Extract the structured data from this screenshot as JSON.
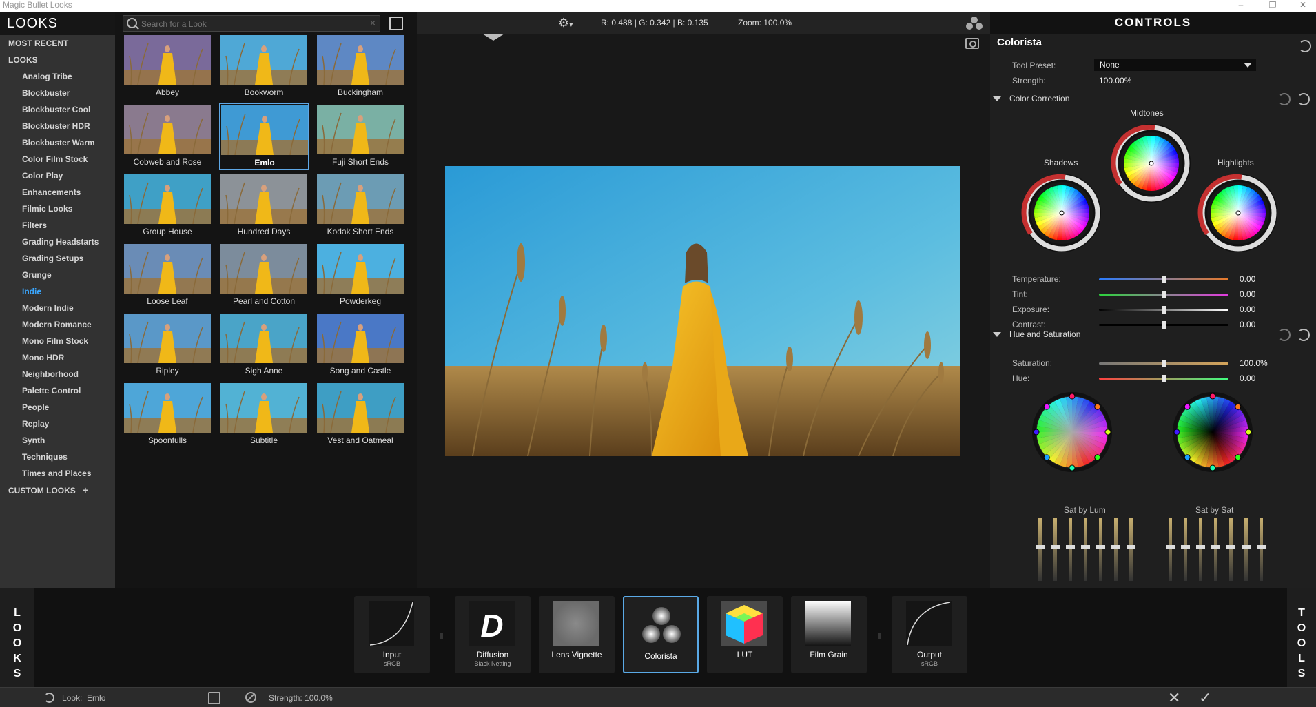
{
  "window": {
    "title": "Magic Bullet Looks"
  },
  "looks_panel": {
    "header": "LOOKS",
    "top_items": [
      "MOST RECENT",
      "LOOKS"
    ],
    "categories": [
      "Analog Tribe",
      "Blockbuster",
      "Blockbuster Cool",
      "Blockbuster HDR",
      "Blockbuster Warm",
      "Color Film Stock",
      "Color Play",
      "Enhancements",
      "Filmic Looks",
      "Filters",
      "Grading Headstarts",
      "Grading Setups",
      "Grunge",
      "Indie",
      "Modern Indie",
      "Modern Romance",
      "Mono Film Stock",
      "Mono HDR",
      "Neighborhood",
      "Palette Control",
      "People",
      "Replay",
      "Synth",
      "Techniques",
      "Times and Places"
    ],
    "selected_category": "Indie",
    "custom_looks": "CUSTOM LOOKS",
    "custom_plus": "+"
  },
  "search": {
    "placeholder": "Search for a Look",
    "clear": "×"
  },
  "thumbnails": [
    {
      "label": "Abbey",
      "tint": "#7a6a9a"
    },
    {
      "label": "Bookworm",
      "tint": "#4fa8d6"
    },
    {
      "label": "Buckingham",
      "tint": "#5e88c4"
    },
    {
      "label": "Cobweb and Rose",
      "tint": "#8a7a8e"
    },
    {
      "label": "Emlo",
      "tint": "#3f9ad4"
    },
    {
      "label": "Fuji Short Ends",
      "tint": "#7ab0a4"
    },
    {
      "label": "Group House",
      "tint": "#3fa0c6"
    },
    {
      "label": "Hundred Days",
      "tint": "#8c9298"
    },
    {
      "label": "Kodak Short Ends",
      "tint": "#6c9cb4"
    },
    {
      "label": "Loose Leaf",
      "tint": "#6a8cb6"
    },
    {
      "label": "Pearl and Cotton",
      "tint": "#7c8c9c"
    },
    {
      "label": "Powderkeg",
      "tint": "#4cb0e0"
    },
    {
      "label": "Ripley",
      "tint": "#5a98c8"
    },
    {
      "label": "Sigh Anne",
      "tint": "#4aa4c8"
    },
    {
      "label": "Song and Castle",
      "tint": "#4a78c6"
    },
    {
      "label": "Spoonfulls",
      "tint": "#4ea6d8"
    },
    {
      "label": "Subtitle",
      "tint": "#52b2d4"
    },
    {
      "label": "Vest and Oatmeal",
      "tint": "#3e9ec4"
    }
  ],
  "selected_thumbnail": "Emlo",
  "viewer": {
    "gear_icon": "gear-icon",
    "gear_caret": "▾",
    "rgb_readout": "R: 0.488 | G: 0.342 | B: 0.135",
    "zoom_readout": "Zoom: 100.0%"
  },
  "controls": {
    "header": "CONTROLS",
    "tool_name": "Colorista",
    "tool_preset_label": "Tool Preset:",
    "tool_preset_value": "None",
    "strength_label": "Strength:",
    "strength_value": "100.00%",
    "color_correction": "Color Correction",
    "wheels": {
      "shadows": "Shadows",
      "midtones": "Midtones",
      "highlights": "Highlights"
    },
    "cc_sliders": [
      {
        "label": "Temperature:",
        "value": "0.00",
        "position": 0.5,
        "colors": [
          "#2a7cff",
          "#e87a2a"
        ]
      },
      {
        "label": "Tint:",
        "value": "0.00",
        "position": 0.5,
        "colors": [
          "#2cd43c",
          "#e43ae0"
        ]
      },
      {
        "label": "Exposure:",
        "value": "0.00",
        "position": 0.5,
        "colors": [
          "#000000",
          "#ffffff"
        ]
      },
      {
        "label": "Contrast:",
        "value": "0.00",
        "position": 0.5,
        "colors": [
          "#000000",
          "#000000"
        ]
      }
    ],
    "hue_saturation": "Hue and Saturation",
    "hs_sliders": [
      {
        "label": "Saturation:",
        "value": "100.0%",
        "position": 0.5,
        "colors": [
          "#777777",
          "#d4a45a"
        ]
      },
      {
        "label": "Hue:",
        "value": "0.00",
        "position": 0.5,
        "colors": [
          "#ff4040",
          "#40ff80"
        ]
      }
    ],
    "sat_by_lum": "Sat by Lum",
    "sat_by_sat": "Sat by Sat"
  },
  "bottom": {
    "left_tab": [
      "L",
      "O",
      "O",
      "K",
      "S"
    ],
    "right_tab": [
      "T",
      "O",
      "O",
      "L",
      "S"
    ],
    "tools": [
      {
        "label": "Input",
        "sub": "sRGB",
        "icon": "input-curve-icon"
      },
      {
        "label": "Diffusion",
        "sub": "Black Netting",
        "icon": "diffusion-icon",
        "glyph": "D"
      },
      {
        "label": "Lens Vignette",
        "sub": "",
        "icon": "lens-vignette-icon"
      },
      {
        "label": "Colorista",
        "sub": "",
        "icon": "colorista-icon"
      },
      {
        "label": "LUT",
        "sub": "",
        "icon": "lut-cube-icon"
      },
      {
        "label": "Film Grain",
        "sub": "",
        "icon": "film-grain-icon"
      },
      {
        "label": "Output",
        "sub": "sRGB",
        "icon": "output-curve-icon"
      }
    ],
    "selected_tool": "Colorista"
  },
  "status": {
    "look_label": "Look:",
    "look_value": "Emlo",
    "strength_label": "Strength:",
    "strength_value": "100.0%",
    "cancel": "✕",
    "ok": "✓"
  }
}
